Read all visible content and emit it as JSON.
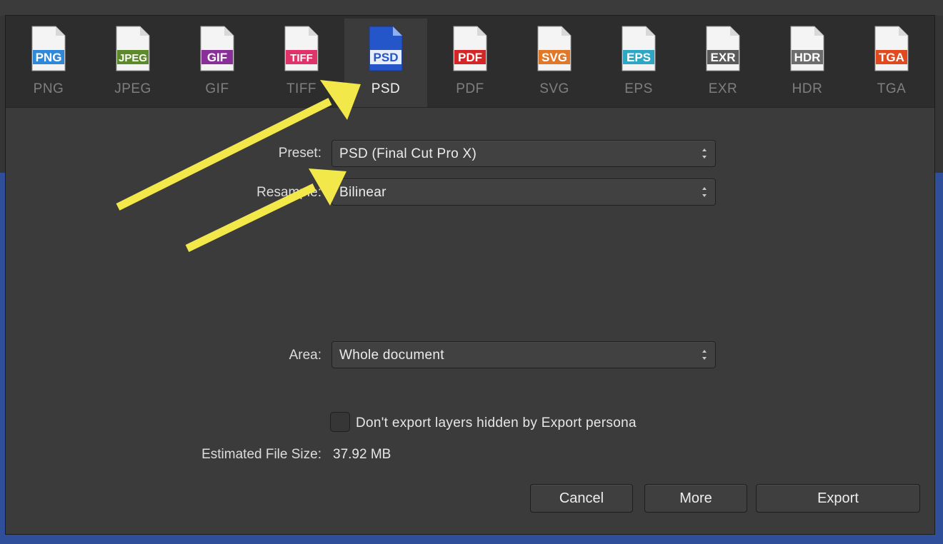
{
  "formats": [
    {
      "id": "png",
      "badge": "PNG",
      "label": "PNG",
      "color": "#2f88d8",
      "active": false
    },
    {
      "id": "jpeg",
      "badge": "JPEG",
      "label": "JPEG",
      "color": "#5d8a2a",
      "active": false
    },
    {
      "id": "gif",
      "badge": "GIF",
      "label": "GIF",
      "color": "#8a2f9a",
      "active": false
    },
    {
      "id": "tiff",
      "badge": "TIFF",
      "label": "TIFF",
      "color": "#e0336a",
      "active": false
    },
    {
      "id": "psd",
      "badge": "PSD",
      "label": "PSD",
      "color": "#2455c9",
      "active": true
    },
    {
      "id": "pdf",
      "badge": "PDF",
      "label": "PDF",
      "color": "#d42626",
      "active": false
    },
    {
      "id": "svg",
      "badge": "SVG",
      "label": "SVG",
      "color": "#e0782a",
      "active": false
    },
    {
      "id": "eps",
      "badge": "EPS",
      "label": "EPS",
      "color": "#2fa6c4",
      "active": false
    },
    {
      "id": "exr",
      "badge": "EXR",
      "label": "EXR",
      "color": "#5a5a5a",
      "active": false
    },
    {
      "id": "hdr",
      "badge": "HDR",
      "label": "HDR",
      "color": "#6d6d6d",
      "active": false
    },
    {
      "id": "tga",
      "badge": "TGA",
      "label": "TGA",
      "color": "#e04a1e",
      "active": false
    }
  ],
  "settings": {
    "preset_label": "Preset:",
    "preset_value": "PSD (Final Cut Pro X)",
    "resample_label": "Resample:",
    "resample_value": "Bilinear",
    "area_label": "Area:",
    "area_value": "Whole document",
    "hidden_layers_label": "Don't export layers hidden by Export persona",
    "hidden_layers_checked": false,
    "filesize_label": "Estimated File Size:",
    "filesize_value": "37.92 MB"
  },
  "buttons": {
    "cancel": "Cancel",
    "more": "More",
    "export": "Export"
  },
  "colors": {
    "annotation_arrow": "#f2e84a",
    "dialog_bg": "#3b3b3b",
    "toolbar_bg": "#2d2d2d"
  }
}
